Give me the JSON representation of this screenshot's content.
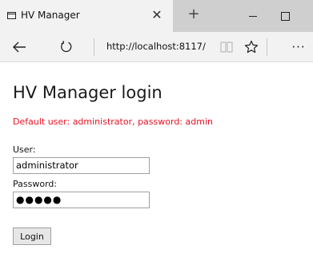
{
  "browser": {
    "tab": {
      "title": "HV Manager",
      "icon": "tab-page-icon",
      "close_glyph": "✕"
    },
    "new_tab_glyph": "+",
    "window_controls": [
      "minimize",
      "maximize"
    ],
    "nav": {
      "back_icon": "back-arrow-icon",
      "refresh_icon": "refresh-icon",
      "url": "http://localhost:8117/",
      "reading_view_icon": "book-icon",
      "favorite_icon": "star-icon",
      "more_glyph": "···"
    }
  },
  "page": {
    "title": "HV Manager login",
    "hint": "Default user: administrator, password: admin",
    "hint_color": "#e81123",
    "user_label": "User:",
    "user_value": "administrator",
    "password_label": "Password:",
    "password_mask": "●●●●●",
    "login_label": "Login"
  }
}
